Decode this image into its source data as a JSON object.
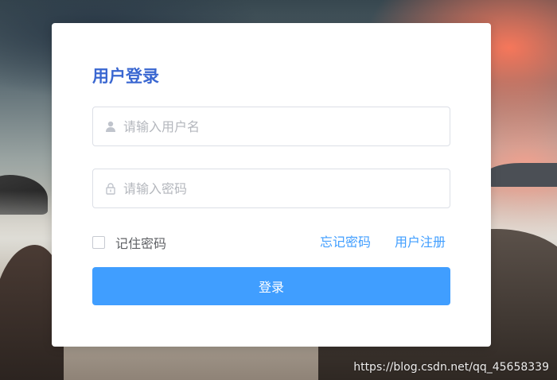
{
  "login": {
    "title": "用户登录",
    "username_placeholder": "请输入用户名",
    "username_value": "",
    "password_placeholder": "请输入密码",
    "password_value": "",
    "remember_label": "记住密码",
    "remember_checked": false,
    "forgot_label": "忘记密码",
    "register_label": "用户注册",
    "submit_label": "登录"
  },
  "icons": {
    "username": "user-icon",
    "password": "lock-icon"
  },
  "colors": {
    "title": "#3a67d1",
    "accent": "#409eff",
    "placeholder": "#b4b7bd"
  },
  "watermark": "https://blog.csdn.net/qq_45658339"
}
